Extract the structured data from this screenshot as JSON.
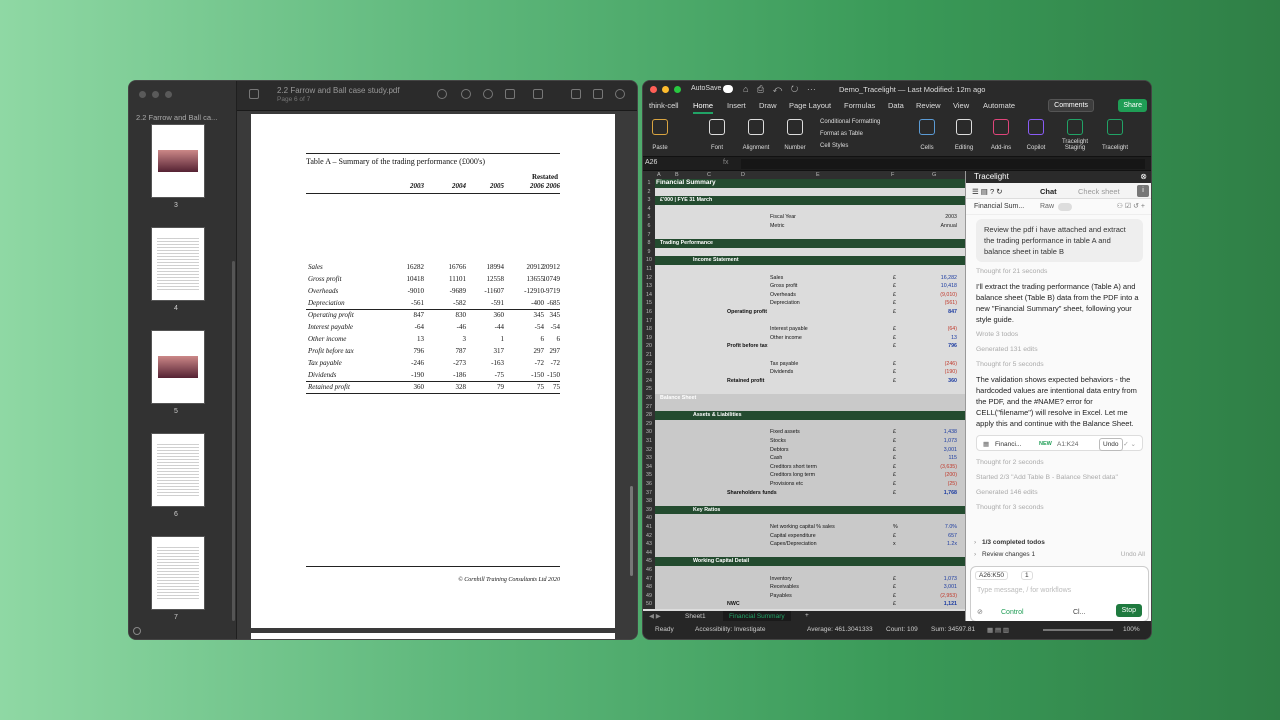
{
  "pdf": {
    "sidebar_title": "2.2 Farrow and Ball ca...",
    "doc_title": "2.2 Farrow and Ball case study.pdf",
    "doc_sub": "Page 6 of 7",
    "thumb_pages": [
      "3",
      "4",
      "5",
      "6",
      "7"
    ],
    "table_title": "Table A – Summary of the trading performance (£000's)",
    "restated": "Restated",
    "years": [
      "2003",
      "2004",
      "2005",
      "2006",
      "2006"
    ],
    "rows": [
      {
        "label": "Sales",
        "v": [
          "16282",
          "16766",
          "18994",
          "20912",
          "20912"
        ]
      },
      {
        "label": "Gross profit",
        "v": [
          "10418",
          "11101",
          "12558",
          "13655",
          "10749"
        ]
      },
      {
        "label": "Overheads",
        "v": [
          "-9010",
          "-9689",
          "-11607",
          "-12910",
          "-9719"
        ]
      },
      {
        "label": "Depreciation",
        "v": [
          "-561",
          "-582",
          "-591",
          "-400",
          "-685"
        ]
      },
      {
        "label": "Operating profit",
        "v": [
          "847",
          "830",
          "360",
          "345",
          "345"
        ]
      },
      {
        "label": "Interest payable",
        "v": [
          "-64",
          "-46",
          "-44",
          "-54",
          "-54"
        ]
      },
      {
        "label": "Other income",
        "v": [
          "13",
          "3",
          "1",
          "6",
          "6"
        ]
      },
      {
        "label": "Profit before tax",
        "v": [
          "796",
          "787",
          "317",
          "297",
          "297"
        ]
      },
      {
        "label": "Tax payable",
        "v": [
          "-246",
          "-273",
          "-163",
          "-72",
          "-72"
        ]
      },
      {
        "label": "Dividends",
        "v": [
          "-190",
          "-186",
          "-75",
          "-150",
          "-150"
        ]
      },
      {
        "label": "Retained profit",
        "v": [
          "360",
          "328",
          "79",
          "75",
          "75"
        ]
      }
    ],
    "footer": "© Cornhill Training Consultants Ltd 2020"
  },
  "excel": {
    "autosave": "AutoSave",
    "file": "Demo_Tracelight — Last Modified: 12m ago",
    "tabs": [
      "think-cell",
      "Home",
      "Insert",
      "Draw",
      "Page Layout",
      "Formulas",
      "Data",
      "Review",
      "View",
      "Automate"
    ],
    "comments": "Comments",
    "share": "Share",
    "ribbon": [
      "Paste",
      "Font",
      "Alignment",
      "Number",
      "Cells",
      "Editing",
      "Add-ins",
      "Copilot",
      "Tracelight Staging",
      "Tracelight"
    ],
    "cond_fmt": [
      "Conditional Formatting",
      "Format as Table",
      "Cell Styles"
    ],
    "name_box": "A26",
    "fx": "fx",
    "cols": [
      "A",
      "B",
      "C",
      "D",
      "E",
      "F",
      "G"
    ],
    "rows": [
      {
        "n": "1",
        "t": "band",
        "label": "Financial Summary"
      },
      {
        "n": "2"
      },
      {
        "n": "3",
        "t": "band",
        "label": "£'000 | FYE 31 March"
      },
      {
        "n": "4"
      },
      {
        "n": "5",
        "lbl": "Fiscal Year",
        "val": "2003",
        "vc": "plain"
      },
      {
        "n": "6",
        "lbl": "Metric",
        "val": "Annual",
        "vc": "plain"
      },
      {
        "n": "7"
      },
      {
        "n": "8",
        "t": "band",
        "label": "Trading Performance"
      },
      {
        "n": "9"
      },
      {
        "n": "10",
        "t": "band2",
        "label": "Income Statement"
      },
      {
        "n": "11"
      },
      {
        "n": "12",
        "lbl": "Sales",
        "unit": "£",
        "val": "16,282"
      },
      {
        "n": "13",
        "lbl": "Gross profit",
        "unit": "£",
        "val": "10,418"
      },
      {
        "n": "14",
        "lbl": "Overheads",
        "unit": "£",
        "val": "(9,010)",
        "vc": "neg"
      },
      {
        "n": "15",
        "lbl": "Depreciation",
        "unit": "£",
        "val": "(561)",
        "vc": "neg"
      },
      {
        "n": "16",
        "blbl": "Operating profit",
        "unit": "£",
        "val": "847",
        "vc": "bold"
      },
      {
        "n": "17"
      },
      {
        "n": "18",
        "lbl": "Interest payable",
        "unit": "£",
        "val": "(64)",
        "vc": "neg"
      },
      {
        "n": "19",
        "lbl": "Other income",
        "unit": "£",
        "val": "13"
      },
      {
        "n": "20",
        "blbl": "Profit before tax",
        "unit": "£",
        "val": "796",
        "vc": "bold"
      },
      {
        "n": "21"
      },
      {
        "n": "22",
        "lbl": "Tax payable",
        "unit": "£",
        "val": "(246)",
        "vc": "neg"
      },
      {
        "n": "23",
        "lbl": "Dividends",
        "unit": "£",
        "val": "(190)",
        "vc": "neg"
      },
      {
        "n": "24",
        "blbl": "Retained profit",
        "unit": "£",
        "val": "360",
        "vc": "bold"
      },
      {
        "n": "25"
      },
      {
        "n": "26",
        "t": "band",
        "label": "Balance Sheet",
        "sel": true
      },
      {
        "n": "27",
        "sel": true
      },
      {
        "n": "28",
        "t": "band2",
        "label": "Assets & Liabilities"
      },
      {
        "n": "29",
        "sel": true
      },
      {
        "n": "30",
        "lbl": "Fixed assets",
        "unit": "£",
        "val": "1,438",
        "sel": true
      },
      {
        "n": "31",
        "lbl": "Stocks",
        "unit": "£",
        "val": "1,073",
        "sel": true
      },
      {
        "n": "32",
        "lbl": "Debtors",
        "unit": "£",
        "val": "3,001",
        "sel": true
      },
      {
        "n": "33",
        "lbl": "Cash",
        "unit": "£",
        "val": "115",
        "sel": true
      },
      {
        "n": "34",
        "lbl": "Creditors short term",
        "unit": "£",
        "val": "(3,635)",
        "vc": "neg",
        "sel": true
      },
      {
        "n": "35",
        "lbl": "Creditors long term",
        "unit": "£",
        "val": "(200)",
        "vc": "neg",
        "sel": true
      },
      {
        "n": "36",
        "lbl": "Provisions etc",
        "unit": "£",
        "val": "(25)",
        "vc": "neg",
        "sel": true
      },
      {
        "n": "37",
        "blbl": "Shareholders funds",
        "unit": "£",
        "val": "1,768",
        "vc": "bold",
        "sel": true
      },
      {
        "n": "38",
        "sel": true
      },
      {
        "n": "39",
        "t": "band2",
        "label": "Key Ratios"
      },
      {
        "n": "40",
        "sel": true
      },
      {
        "n": "41",
        "lbl": "Net working capital % sales",
        "unit": "%",
        "val": "7.0%",
        "sel": true
      },
      {
        "n": "42",
        "lbl": "Capital expenditure",
        "unit": "£",
        "val": "657",
        "sel": true
      },
      {
        "n": "43",
        "lbl": "Capex/Depreciation",
        "unit": "x",
        "val": "1.2x",
        "sel": true
      },
      {
        "n": "44",
        "sel": true
      },
      {
        "n": "45",
        "t": "band2",
        "label": "Working Capital Detail"
      },
      {
        "n": "46",
        "sel": true
      },
      {
        "n": "47",
        "lbl": "Inventory",
        "unit": "£",
        "val": "1,073",
        "sel": true
      },
      {
        "n": "48",
        "lbl": "Receivables",
        "unit": "£",
        "val": "3,001",
        "sel": true
      },
      {
        "n": "49",
        "lbl": "Payables",
        "unit": "£",
        "val": "(2,953)",
        "vc": "neg",
        "sel": true
      },
      {
        "n": "50",
        "blbl": "NWC",
        "unit": "£",
        "val": "1,121",
        "vc": "bold",
        "sel": true
      }
    ],
    "sheets": [
      "Sheet1",
      "Financial Summary"
    ],
    "status": {
      "ready": "Ready",
      "access": "Accessibility: Investigate",
      "avg": "Average: 461.3041333",
      "count": "Count: 109",
      "sum": "Sum: 34597.81",
      "zoom": "100%"
    }
  },
  "panel": {
    "title": "Tracelight",
    "tab_chat": "Chat",
    "tab_sheet": "Check sheet",
    "sub_name": "Financial Sum...",
    "sub_raw": "Raw",
    "user_msg": "Review the pdf i have attached and extract the trading performance in table A and balance sheet in table B",
    "thought1": "Thought for 21 seconds",
    "reply1": "I'll extract the trading performance (Table A) and balance sheet (Table B) data from the PDF into a new \"Financial Summary\" sheet, following your style guide.",
    "wrote": "Wrote 3 todos",
    "generated": "Generated 131 edits",
    "thought2": "Thought for 5 seconds",
    "reply2": "The validation shows expected behaviors - the hardcoded values are intentional data entry from the PDF, and the #NAME? error for CELL(\"filename\") will resolve in Excel. Let me apply this and continue with the Balance Sheet.",
    "card_name": "Financi...",
    "card_new": "NEW",
    "card_range": "A1:K24",
    "card_undo": "Undo",
    "thought3": "Thought for 2 seconds",
    "started": "Started 2/3 \"Add Table B - Balance Sheet data\"",
    "generated2": "Generated 146 edits",
    "thought4": "Thought for 3 seconds",
    "todo1": "1/3 completed todos",
    "todo2": "Review changes 1",
    "undo_all": "Undo All",
    "ref": "A26:K50",
    "ref_count": "1",
    "placeholder": "Type message, / for workflows",
    "control": "Control",
    "model": "Cl...",
    "stop": "Stop"
  }
}
